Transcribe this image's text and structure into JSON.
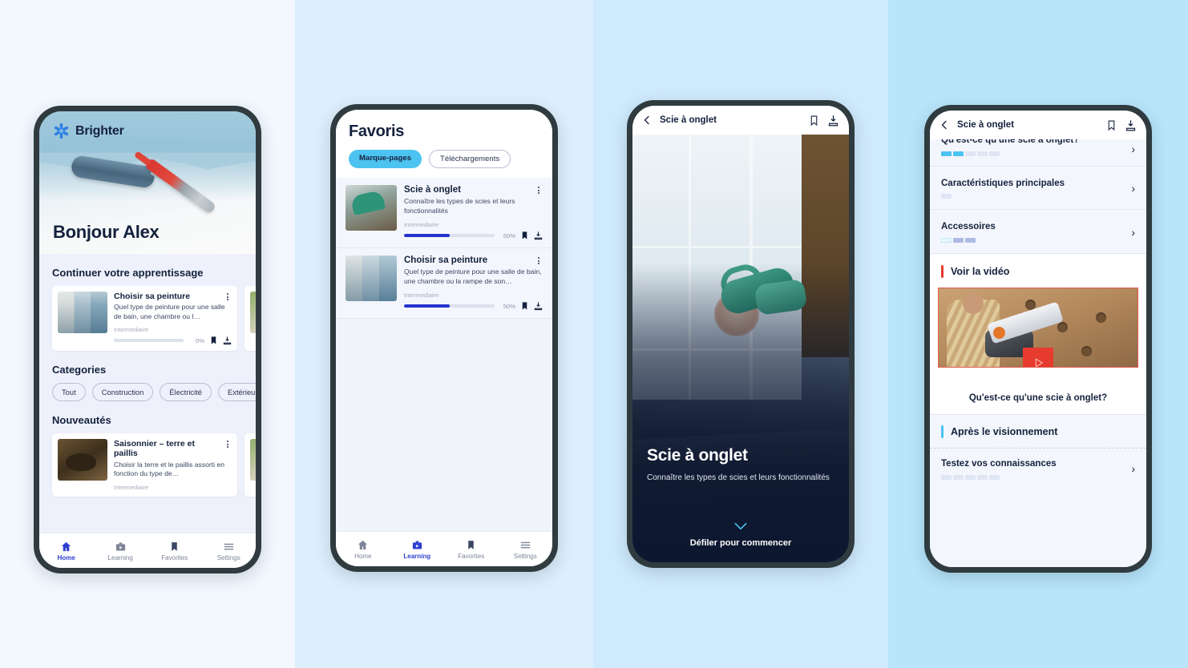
{
  "panels": {
    "bg1": "#f2f8fe",
    "bg2": "#ddeffc",
    "bg3": "#cfeafc",
    "bg4": "#b8e5fa"
  },
  "colors": {
    "ink": "#14213d",
    "accent_blue": "#2233cc",
    "accent_cyan": "#4cc3f0",
    "accent_red": "#e63b2e",
    "nav_active": "#2f3fd0"
  },
  "phone1": {
    "brand": "Brighter",
    "greeting": "Bonjour Alex",
    "section_continue": "Continuer votre apprentissage",
    "section_categories": "Categories",
    "section_new": "Nouveautés",
    "continue_cards": [
      {
        "title": "Choisir sa peinture",
        "desc": "Quel type de peinture pour une salle de bain, une chambre ou l…",
        "level": "Intermediaire",
        "progress": "0%",
        "progress_value": 0
      }
    ],
    "categories": [
      "Tout",
      "Construction",
      "Électricité",
      "Extérieur"
    ],
    "new_cards": [
      {
        "title": "Saisonnier – terre et paillis",
        "desc": "Choisir la terre et le paillis assorti en fonction du type de…",
        "level": "Intermediaire"
      }
    ],
    "tabs": [
      {
        "label": "Home",
        "icon": "home-icon",
        "active": true
      },
      {
        "label": "Learning",
        "icon": "learning-icon",
        "active": false
      },
      {
        "label": "Favorites",
        "icon": "bookmark-icon",
        "active": false
      },
      {
        "label": "Settings",
        "icon": "menu-icon",
        "active": false
      }
    ]
  },
  "phone2": {
    "title": "Favoris",
    "segments": [
      {
        "label": "Marque-pages",
        "selected": true
      },
      {
        "label": "Téléchargements",
        "selected": false
      }
    ],
    "rows": [
      {
        "title": "Scie à onglet",
        "desc": "Connaître les types de scies et leurs fonctionnalités",
        "level": "Intermediaire",
        "progress": "50%",
        "progress_value": 50
      },
      {
        "title": "Choisir sa peinture",
        "desc": "Quel type de peinture pour une salle de bain, une chambre ou la rampe de son…",
        "level": "Intermediaire",
        "progress": "50%",
        "progress_value": 50
      }
    ],
    "tabs": [
      {
        "label": "Home",
        "icon": "home-icon",
        "active": false
      },
      {
        "label": "Learning",
        "icon": "learning-icon",
        "active": true
      },
      {
        "label": "Favorites",
        "icon": "bookmark-icon",
        "active": false
      },
      {
        "label": "Settings",
        "icon": "menu-icon",
        "active": false
      }
    ]
  },
  "phone3": {
    "topbar_title": "Scie à onglet",
    "hero_title": "Scie à onglet",
    "hero_subtitle": "Connaître les types de scies et leurs fonctionnalités",
    "scroll_hint": "Défiler pour commencer"
  },
  "phone4": {
    "topbar_title": "Scie à onglet",
    "rows_top": [
      {
        "title": "Qu'est-ce qu'une scie à onglet?",
        "segments": [
          "on",
          "on",
          "off",
          "off",
          "off"
        ],
        "clipped": true
      },
      {
        "title": "Caractéristiques principales",
        "segments": [
          "off"
        ],
        "clipped": false
      },
      {
        "title": "Accessoires",
        "segments": [
          "pale",
          "mid",
          "mid"
        ],
        "clipped": false
      }
    ],
    "video_section_title": "Voir la vidéo",
    "video_caption": "Qu'est-ce qu'une scie à onglet?",
    "after_section_title": "Après le visionnement",
    "rows_bottom": [
      {
        "title": "Testez vos connaissances",
        "segments": [
          "off",
          "off",
          "off",
          "off",
          "off"
        ],
        "clipped": false
      }
    ]
  }
}
